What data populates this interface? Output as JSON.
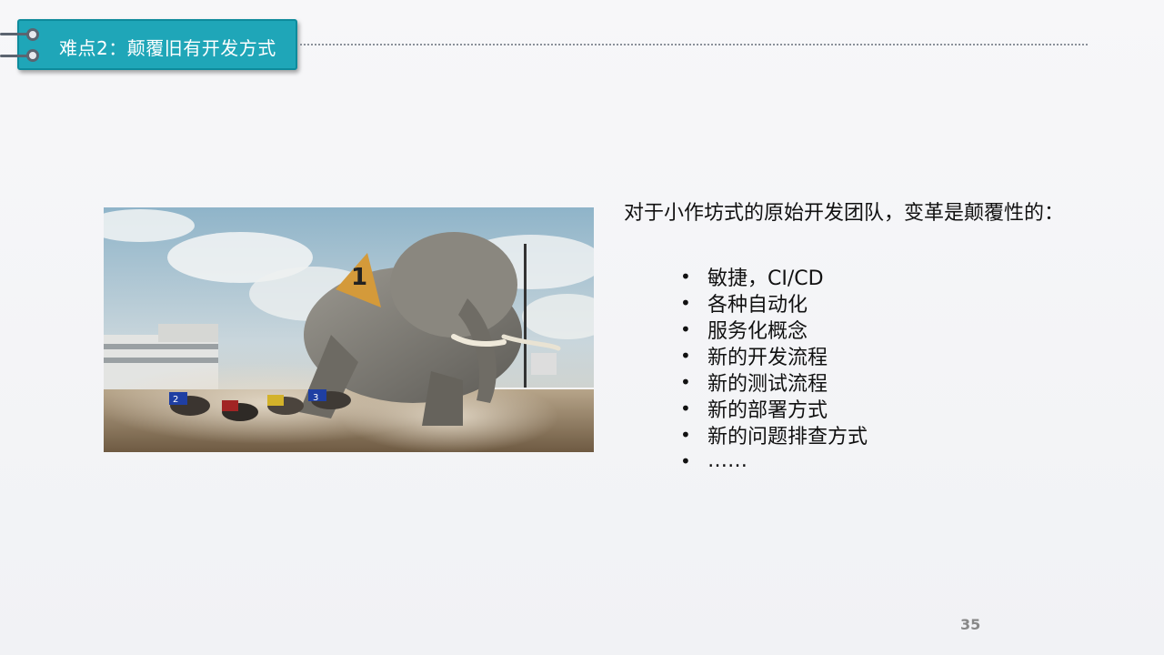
{
  "header": {
    "title": "难点2：颠覆旧有开发方式"
  },
  "intro": "对于小作坊式的原始开发团队，变革是颠覆性的：",
  "bullets": [
    "敏捷，CI/CD",
    "各种自动化",
    "服务化概念",
    "新的开发流程",
    "新的测试流程",
    "新的部署方式",
    "新的问题排查方式",
    "……"
  ],
  "bullet_symbol": "•",
  "photo": {
    "icon": "elephant-racing-photo",
    "bib_numbers": [
      "1",
      "2",
      "3"
    ]
  },
  "page_number": "35",
  "colors": {
    "accent": "#1fa6b8",
    "ring": "#5b6470"
  }
}
